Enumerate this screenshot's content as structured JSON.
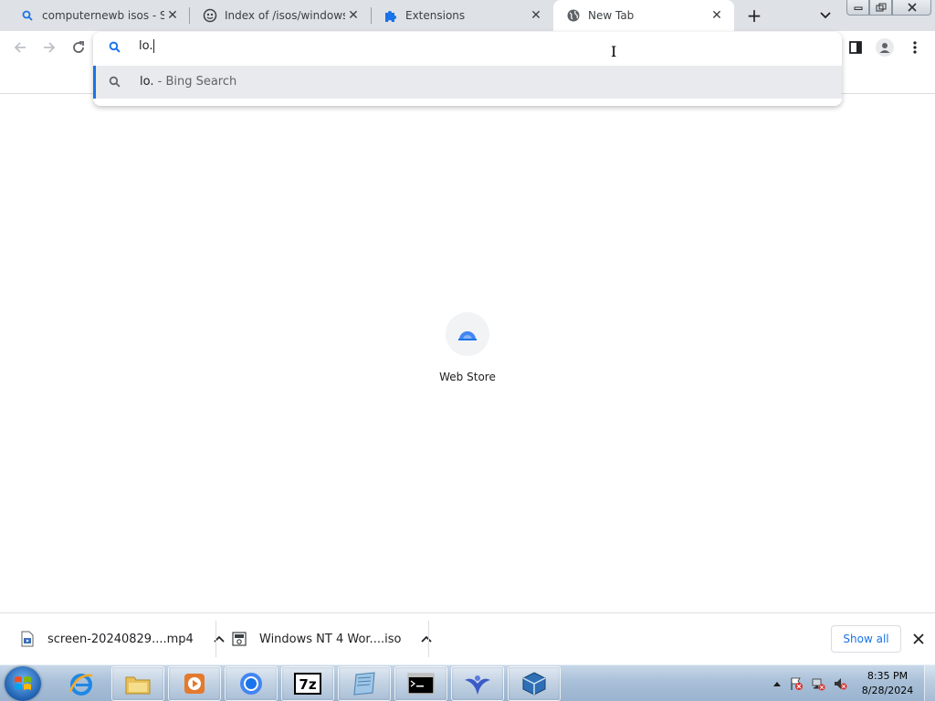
{
  "tabs": [
    {
      "label": "computernewb isos - Sea",
      "icon": "search-icon"
    },
    {
      "label": "Index of /isos/windows/",
      "icon": "site-logo-icon"
    },
    {
      "label": "Extensions",
      "icon": "puzzle-icon"
    },
    {
      "label": "New Tab",
      "icon": "globe-icon",
      "active": true
    }
  ],
  "omnibox": {
    "typed": "lo.",
    "suggestion_query": "lo.",
    "suggestion_provider": " - Bing Search"
  },
  "ntp": {
    "tile_label": "Web Store"
  },
  "downloads": {
    "items": [
      {
        "name": "screen-20240829....mp4",
        "icon": "video-file-icon"
      },
      {
        "name": "Windows NT 4 Wor....iso",
        "icon": "iso-file-icon"
      }
    ],
    "show_all_label": "Show all"
  },
  "taskbar": {
    "time": "8:35 PM",
    "date": "8/28/2024"
  },
  "colors": {
    "accent": "#1a73e8",
    "tabstrip": "#dee1e6"
  }
}
